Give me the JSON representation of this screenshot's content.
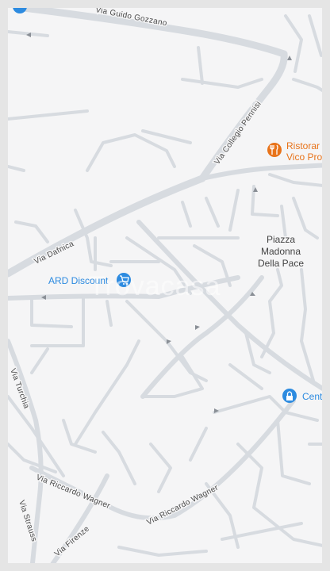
{
  "map": {
    "streets": {
      "guido_gozzano": "Via Guido Gozzano",
      "collegio_pennisi": "Via Collegio Pennisi",
      "dafnica": "Via Dafnica",
      "turchia": "Via Turchia",
      "riccardo_wagner_1": "Via Riccardo Wagner",
      "riccardo_wagner_2": "Via Riccardo Wagner",
      "strauss": "Via Strauss",
      "firenze": "Via Firenze"
    },
    "places": {
      "piazza_line1": "Piazza",
      "piazza_line2": "Madonna",
      "piazza_line3": "Della Pace"
    },
    "pois": [
      {
        "label": "Ristorar",
        "label2": "Vico Pro",
        "icon": "restaurant-icon",
        "color": "#e8731a"
      },
      {
        "label": "ARD Discount",
        "icon": "shopping-cart-icon",
        "color": "#2d8be0"
      },
      {
        "label": "Cent",
        "icon": "lock-icon",
        "color": "#2d8be0"
      }
    ],
    "watermark": "Trovacasa",
    "colors": {
      "background": "#f5f5f6",
      "road": "#d7dbe0",
      "border": "#e5e5e5",
      "poi_blue": "#2d8be0",
      "poi_orange": "#e8731a"
    }
  }
}
